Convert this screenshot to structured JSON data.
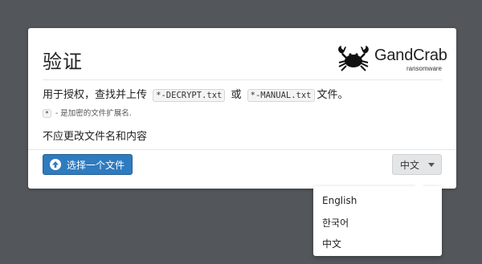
{
  "dialog": {
    "title": "验证",
    "logo": {
      "name": "GandCrab",
      "subtitle": "ransomware"
    },
    "instruction": {
      "prefix": "用于授权，查找并上传",
      "file1": "*-DECRYPT.txt",
      "middle": "或",
      "file2": "*-MANUAL.txt",
      "suffix": "文件。"
    },
    "note": {
      "code": "*",
      "text": "- 是加密的文件扩展名."
    },
    "warning": "不应更改文件名和内容",
    "select_button": {
      "label": "选择一个文件",
      "icon": "upload-arrow-icon"
    },
    "language_button": {
      "label": "中文",
      "icon": "caret-down-icon"
    }
  },
  "language_menu": {
    "items": [
      "English",
      "한국어",
      "中文"
    ]
  },
  "colors": {
    "background": "#53575b",
    "primary_button": "#2f7bbf",
    "language_button": "#e4e5e6"
  }
}
